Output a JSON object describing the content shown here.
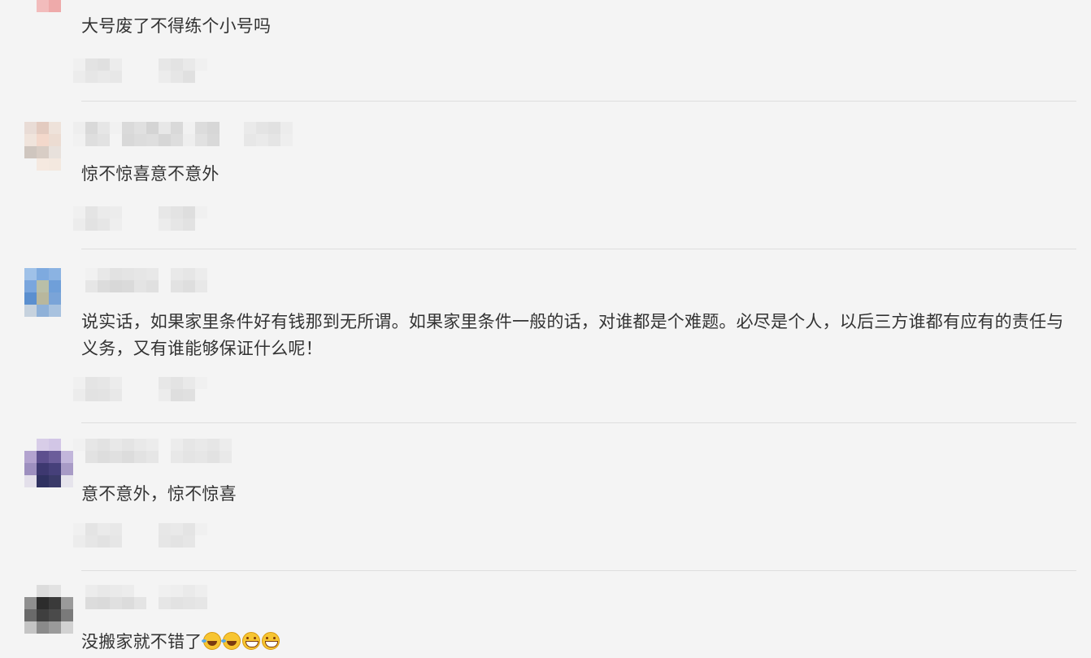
{
  "comments": [
    {
      "text": "大号废了不得练个小号吗",
      "emoji": []
    },
    {
      "text": "惊不惊喜意不意外",
      "emoji": []
    },
    {
      "text": "说实话，如果家里条件好有钱那到无所谓。如果家里条件一般的话，对谁都是个难题。必尽是个人，以后三方谁都有应有的责任与义务，又有谁能够保证什么呢！",
      "emoji": []
    },
    {
      "text": "意不意外，惊不惊喜",
      "emoji": []
    },
    {
      "text": "没搬家就不错了",
      "emoji": [
        "laughing-crying-emoji",
        "laughing-crying-emoji",
        "grinning-emoji",
        "grinning-emoji"
      ]
    }
  ],
  "colors": {
    "background": "#f4f4f4",
    "text": "#333333",
    "divider": "#dedede"
  }
}
